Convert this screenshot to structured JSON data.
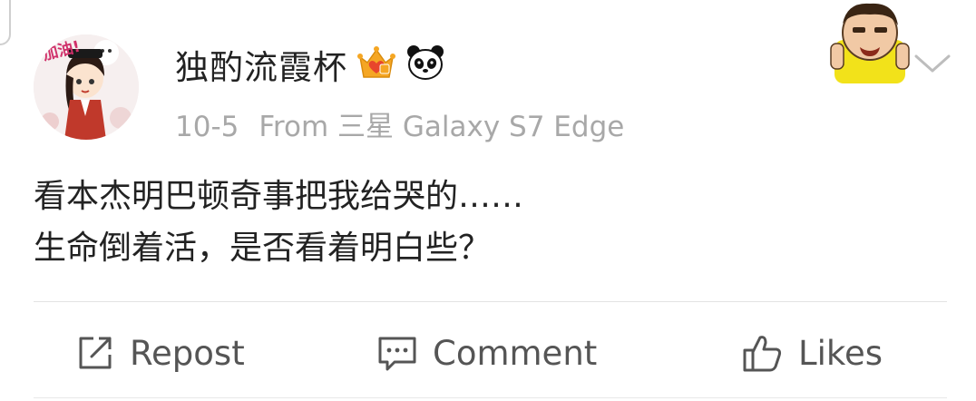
{
  "post": {
    "user_name": "独酌流霞杯",
    "meta": {
      "date": "10-5",
      "source": "From 三星 Galaxy S7 Edge"
    },
    "text_lines": [
      "看本杰明巴顿奇事把我给哭的……",
      "生命倒着活，是否看着明白些？"
    ],
    "avatar_text": "加油!"
  },
  "icons": {
    "vip_badge": "crown-vip-icon",
    "panda_badge": "panda-icon",
    "menu": "chevron-down-icon",
    "repost": "repost-icon",
    "comment": "comment-icon",
    "likes": "thumbs-up-icon"
  },
  "actions": {
    "repost_label": "Repost",
    "comment_label": "Comment",
    "likes_label": "Likes"
  },
  "colors": {
    "vip_crown": "#f5a623",
    "vip_heart": "#e8452c",
    "text_primary": "#222222",
    "text_secondary": "#a8a8a8",
    "action_text": "#555555"
  }
}
